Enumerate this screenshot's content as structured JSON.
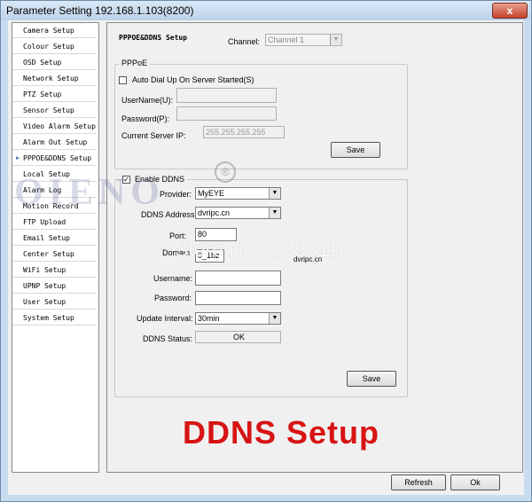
{
  "window": {
    "title": "Parameter Setting 192.168.1.103(8200)",
    "close_label": "x"
  },
  "sidebar": {
    "items": [
      {
        "label": "Camera Setup"
      },
      {
        "label": "Colour Setup"
      },
      {
        "label": "OSD Setup"
      },
      {
        "label": "Network Setup"
      },
      {
        "label": "PTZ Setup"
      },
      {
        "label": "Sensor Setup"
      },
      {
        "label": "Video Alarm Setup"
      },
      {
        "label": "Alarm Out Setup"
      },
      {
        "label": "PPPOE&DDNS Setup",
        "selected": true
      },
      {
        "label": "Local Setup"
      },
      {
        "label": "Alarm Log"
      },
      {
        "label": "Motion Record"
      },
      {
        "label": "FTP Upload"
      },
      {
        "label": "Email Setup"
      },
      {
        "label": "Center Setup"
      },
      {
        "label": "WiFi Setup"
      },
      {
        "label": "UPNP Setup"
      },
      {
        "label": "User Setup"
      },
      {
        "label": "System Setup"
      }
    ],
    "selected_marker": "▶"
  },
  "panel": {
    "title": "PPPOE&DDNS Setup",
    "channel_label": "Channel:",
    "channel_value": "Channel 1"
  },
  "pppoe": {
    "group_label": "PPPoE",
    "auto_dial_label": "Auto Dial Up On Server Started(S)",
    "auto_dial_checked": false,
    "username_label": "UserName(U):",
    "username_value": "",
    "password_label": "Password(P):",
    "password_value": "",
    "server_ip_label": "Current Server IP:",
    "server_ip_value": "255.255.255.255",
    "save_label": "Save"
  },
  "ddns": {
    "enable_label": "Enable DDNS",
    "enable_checked": true,
    "provider_label": "Provider:",
    "provider_value": "MyEYE",
    "address_label": "DDNS Address:",
    "address_value": "dvripc.cn",
    "port_label": "Port:",
    "port_value": "80",
    "domain_label": "Domain:",
    "domain_value": "0_1bz",
    "domain_suffix": "dvripc.cn",
    "username_label": "Username:",
    "username_value": "",
    "password_label": "Password:",
    "password_value": "",
    "interval_label": "Update Interval:",
    "interval_value": "30min",
    "status_label": "DDNS Status:",
    "status_value": "OK",
    "save_label": "Save"
  },
  "watermark": {
    "brand": "OIENO",
    "registered": "®",
    "store": "Store No.: 1393116"
  },
  "caption": "DDNS Setup",
  "footer": {
    "refresh_label": "Refresh",
    "ok_label": "Ok"
  },
  "colors": {
    "caption": "#d71414",
    "titlebar": "#c9dcef"
  }
}
